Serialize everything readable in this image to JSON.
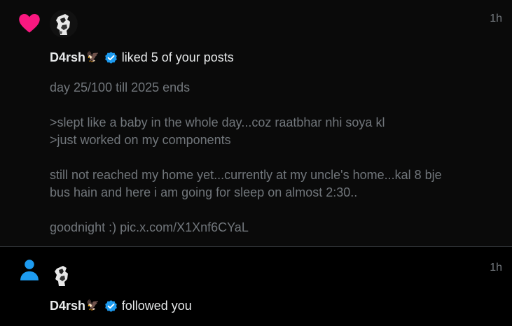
{
  "notifications": [
    {
      "type_icon": "heart-icon",
      "type_color": "#f91880",
      "user": {
        "name": "D4rsh",
        "emoji": "🦅",
        "verified": true,
        "verified_color": "#1d9bf0"
      },
      "action": "liked 5 of your posts",
      "time": "1h",
      "post": {
        "lines": [
          "day 25/100 till 2025 ends",
          "",
          ">slept like a baby in the whole day...coz raatbhar nhi soya kl",
          ">just worked on my components",
          "",
          "still not reached my home yet...currently at my uncle's home...kal 8 bje",
          "bus hain and here i am going for sleep on almost 2:30..",
          "",
          "goodnight :) pic.x.com/X1Xnf6CYaL"
        ]
      }
    },
    {
      "type_icon": "person-icon",
      "type_color": "#1d9bf0",
      "user": {
        "name": "D4rsh",
        "emoji": "🦅",
        "verified": true,
        "verified_color": "#1d9bf0"
      },
      "action": "followed you",
      "time": "1h"
    }
  ]
}
